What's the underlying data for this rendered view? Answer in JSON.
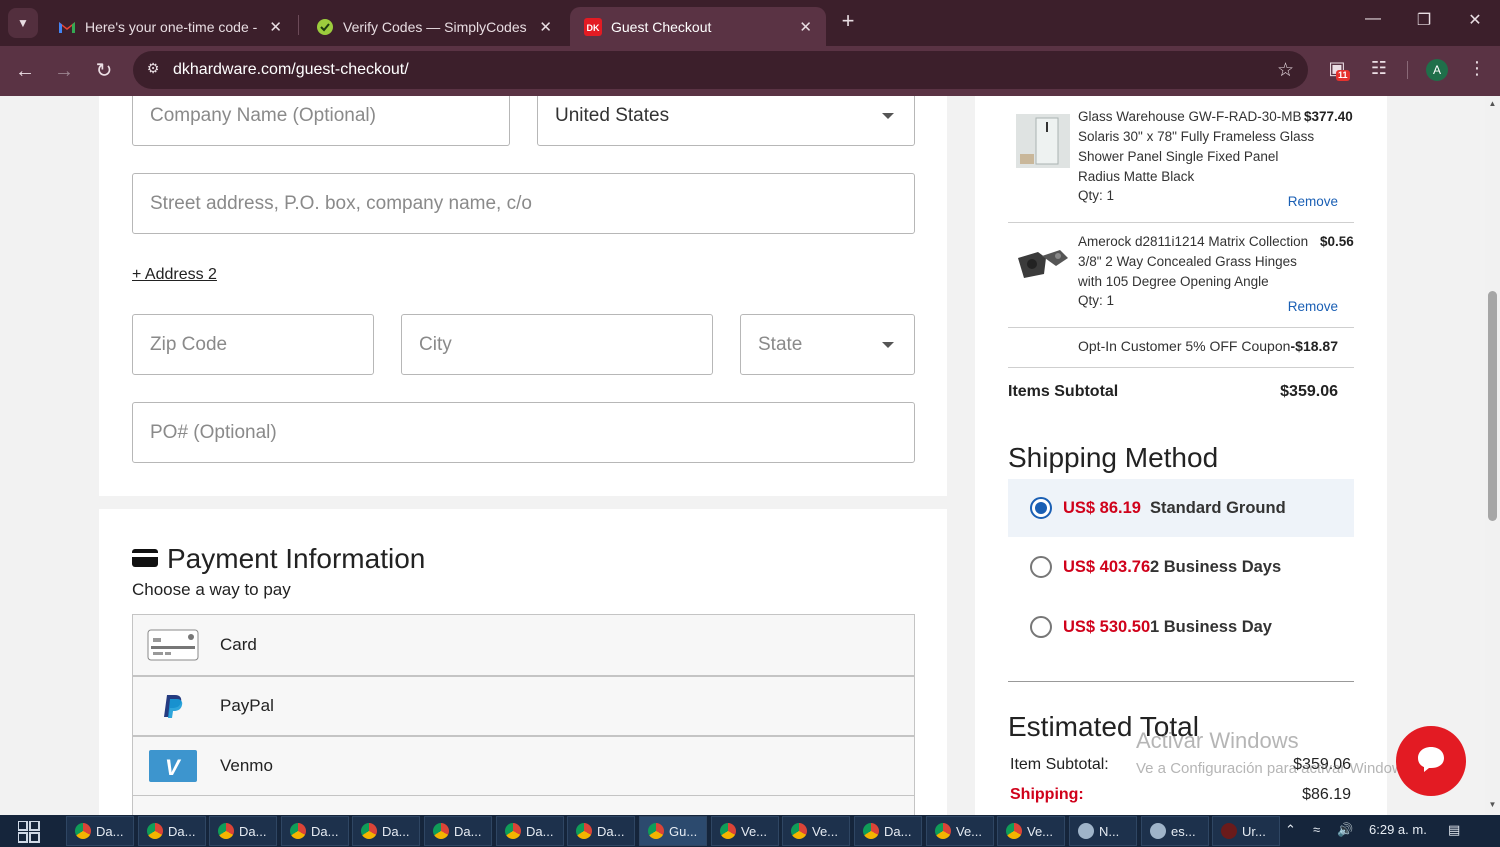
{
  "browser": {
    "tabs": [
      {
        "title": "Here's your one-time code - an",
        "icon": "gmail-icon",
        "active": false
      },
      {
        "title": "Verify Codes — SimplyCodes",
        "icon": "simplycodes-icon",
        "active": false
      },
      {
        "title": "Guest Checkout",
        "icon": "dk-icon",
        "active": true
      }
    ],
    "url": "dkhardware.com/guest-checkout/",
    "extension_badge": "11",
    "avatar_letter": "A"
  },
  "address_form": {
    "company_placeholder": "Company Name (Optional)",
    "country_value": "United States",
    "street_placeholder": "Street address, P.O. box, company name, c/o",
    "address2_link": "+ Address 2",
    "zip_placeholder": "Zip Code",
    "city_placeholder": "City",
    "state_placeholder": "State",
    "po_placeholder": "PO# (Optional)"
  },
  "payment": {
    "title": "Payment Information",
    "subtitle": "Choose a way to pay",
    "options": [
      {
        "label": "Card",
        "icon": "card-icon"
      },
      {
        "label": "PayPal",
        "icon": "paypal-icon"
      },
      {
        "label": "Venmo",
        "icon": "venmo-icon"
      }
    ]
  },
  "cart": {
    "items": [
      {
        "name": "Glass Warehouse GW-F-RAD-30-MB Solaris 30\" x 78\" Fully Frameless Glass Shower Panel Single Fixed Panel Radius Matte Black",
        "price": "$377.40",
        "qty": "Qty: 1",
        "remove": "Remove"
      },
      {
        "name": "Amerock d2811i1214 Matrix Collection 3/8\" 2 Way Concealed Grass Hinges with 105 Degree Opening Angle",
        "price": "$0.56",
        "qty": "Qty: 1",
        "remove": "Remove"
      }
    ],
    "coupon_label": "Opt-In Customer 5% OFF Coupon",
    "coupon_value": "-$18.87",
    "subtotal_label": "Items Subtotal",
    "subtotal_value": "$359.06"
  },
  "shipping": {
    "title": "Shipping Method",
    "options": [
      {
        "price": "US$ 86.19",
        "desc": "Standard Ground",
        "selected": true
      },
      {
        "price": "US$ 403.76",
        "desc": "2 Business Days",
        "selected": false
      },
      {
        "price": "US$ 530.50",
        "desc": "1 Business Day",
        "selected": false
      }
    ]
  },
  "estimate": {
    "title": "Estimated Total",
    "item_subtotal_label": "Item Subtotal:",
    "item_subtotal_value": "$359.06",
    "shipping_label": "Shipping:",
    "shipping_value": "$86.19"
  },
  "watermark": {
    "line1": "Activar Windows",
    "line2": "Ve a Configuración para activar Windows."
  },
  "taskbar": {
    "apps": [
      {
        "label": "Da...",
        "active": false
      },
      {
        "label": "Da...",
        "active": false
      },
      {
        "label": "Da...",
        "active": false
      },
      {
        "label": "Da...",
        "active": false
      },
      {
        "label": "Da...",
        "active": false
      },
      {
        "label": "Da...",
        "active": false
      },
      {
        "label": "Da...",
        "active": false
      },
      {
        "label": "Da...",
        "active": false
      },
      {
        "label": "Gu...",
        "active": true
      },
      {
        "label": "Ve...",
        "active": false
      },
      {
        "label": "Ve...",
        "active": false
      },
      {
        "label": "Da...",
        "active": false
      },
      {
        "label": "Ve...",
        "active": false
      },
      {
        "label": "Ve...",
        "active": false
      },
      {
        "label": "N...",
        "active": false
      },
      {
        "label": "es...",
        "active": false
      },
      {
        "label": "Ur...",
        "active": false
      }
    ],
    "clock": "6:29 a. m."
  },
  "colors": {
    "accent_blue": "#1a5fb4",
    "price_red": "#d0021b",
    "brand_red": "#e31b23"
  }
}
